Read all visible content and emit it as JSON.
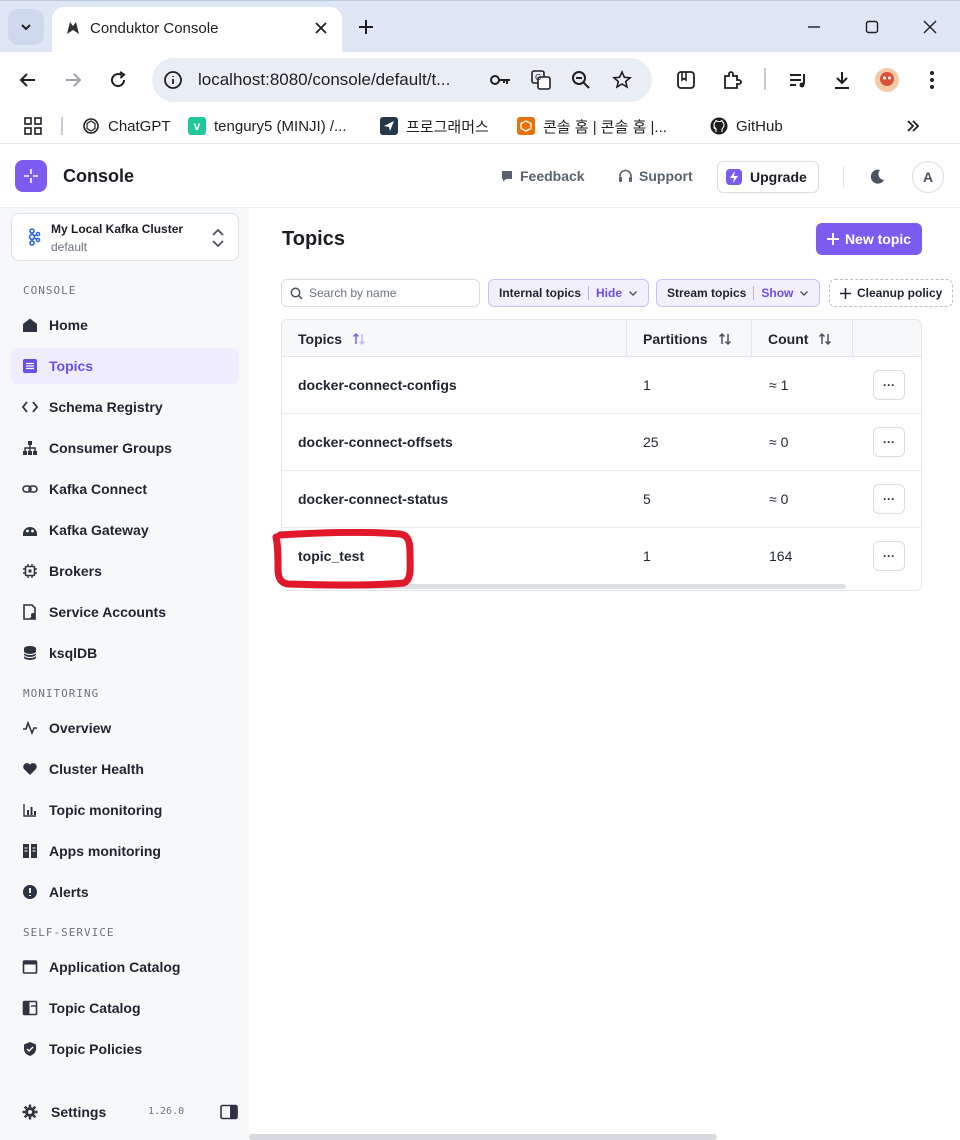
{
  "browser": {
    "tab_title": "Conduktor Console",
    "url": "localhost:8080/console/default/t...",
    "bookmarks": [
      {
        "label": "ChatGPT",
        "icon": "chatgpt-icon"
      },
      {
        "label": "tengury5 (MINJI) /...",
        "icon": "velog-icon",
        "badge": "v",
        "color": "#20c997"
      },
      {
        "label": "프로그래머스",
        "icon": "programmers-icon",
        "color": "#263747"
      },
      {
        "label": "콘솔 홈 | 콘솔 홈 |...",
        "icon": "aws-console-icon",
        "color": "#e8710a"
      },
      {
        "label": "GitHub",
        "icon": "github-icon"
      }
    ]
  },
  "app": {
    "brand": "Console",
    "header": {
      "feedback": "Feedback",
      "support": "Support",
      "upgrade": "Upgrade",
      "avatar_initial": "A"
    },
    "cluster": {
      "name": "My Local Kafka Cluster",
      "env": "default"
    },
    "sidebar": {
      "sections": [
        {
          "label": "CONSOLE"
        },
        {
          "label": "MONITORING"
        },
        {
          "label": "SELF-SERVICE"
        }
      ],
      "items": [
        {
          "label": "Home",
          "icon": "home-icon"
        },
        {
          "label": "Topics",
          "icon": "topics-icon",
          "active": true
        },
        {
          "label": "Schema Registry",
          "icon": "code-icon"
        },
        {
          "label": "Consumer Groups",
          "icon": "hierarchy-icon"
        },
        {
          "label": "Kafka Connect",
          "icon": "link-icon"
        },
        {
          "label": "Kafka Gateway",
          "icon": "gateway-icon"
        },
        {
          "label": "Brokers",
          "icon": "chip-icon"
        },
        {
          "label": "Service Accounts",
          "icon": "user-file-icon"
        },
        {
          "label": "ksqlDB",
          "icon": "database-icon"
        },
        {
          "label": "Overview",
          "icon": "pulse-icon"
        },
        {
          "label": "Cluster Health",
          "icon": "heart-icon"
        },
        {
          "label": "Topic monitoring",
          "icon": "bar-chart-icon"
        },
        {
          "label": "Apps monitoring",
          "icon": "columns-icon"
        },
        {
          "label": "Alerts",
          "icon": "alert-icon"
        },
        {
          "label": "Application Catalog",
          "icon": "window-icon"
        },
        {
          "label": "Topic Catalog",
          "icon": "layout-icon"
        },
        {
          "label": "Topic Policies",
          "icon": "shield-icon"
        }
      ],
      "settings": "Settings",
      "version": "1.26.0"
    },
    "main": {
      "title": "Topics",
      "new_topic": "New topic",
      "search_placeholder": "Search by name",
      "filters": [
        {
          "label": "Internal topics",
          "value": "Hide"
        },
        {
          "label": "Stream topics",
          "value": "Show"
        }
      ],
      "cleanup": "Cleanup policy",
      "columns": [
        "Topics",
        "Partitions",
        "Count"
      ],
      "rows": [
        {
          "name": "docker-connect-configs",
          "partitions": "1",
          "count": "≈ 1"
        },
        {
          "name": "docker-connect-offsets",
          "partitions": "25",
          "count": "≈ 0"
        },
        {
          "name": "docker-connect-status",
          "partitions": "5",
          "count": "≈ 0"
        },
        {
          "name": "topic_test",
          "partitions": "1",
          "count": "164"
        }
      ],
      "row_menu": "···"
    }
  },
  "colors": {
    "accent": "#7b5cf0",
    "highlight": "#e0182a"
  }
}
